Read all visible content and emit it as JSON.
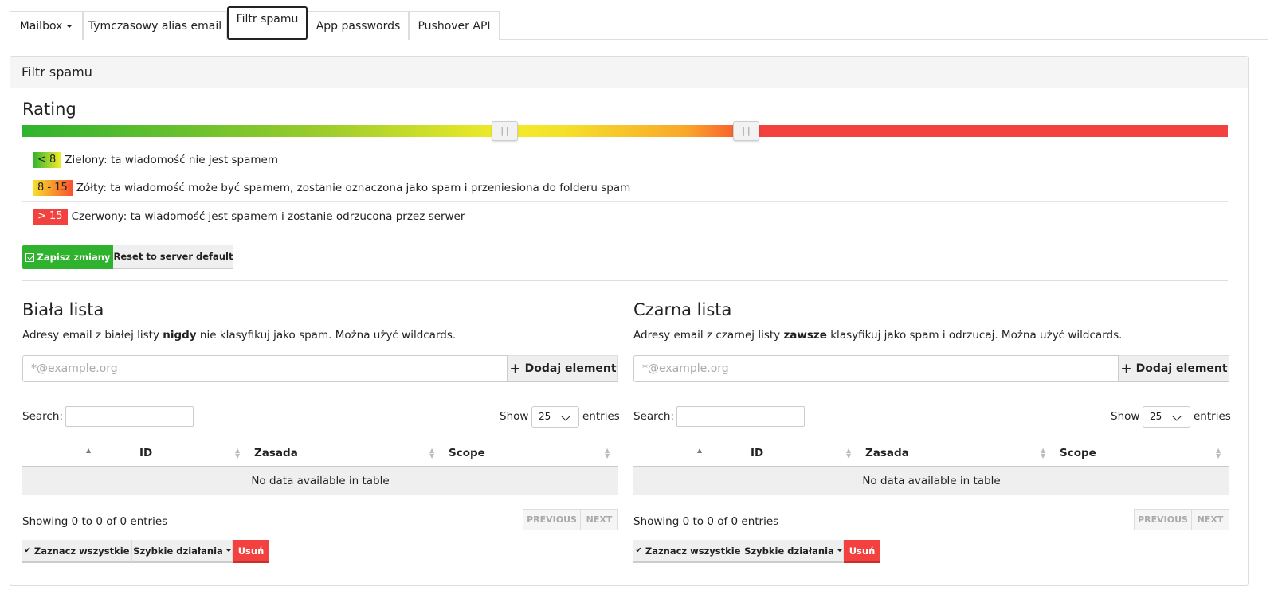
{
  "tabs": [
    {
      "label": "Mailbox",
      "dropdown": true
    },
    {
      "label": "Tymczasowy alias email"
    },
    {
      "label": "Filtr spamu",
      "active": true
    },
    {
      "label": "App passwords"
    },
    {
      "label": "Pushover API"
    }
  ],
  "panel": {
    "title": "Filtr spamu",
    "rating_title": "Rating",
    "slider": {
      "low": 8,
      "high": 15
    },
    "rating_rows": [
      {
        "badge": "< 8",
        "text": "Zielony: ta wiadomość nie jest spamem",
        "color": "green"
      },
      {
        "badge": "8 - 15",
        "text": "Żółty: ta wiadomość może być spamem, zostanie oznaczona jako spam i przeniesiona do folderu spam",
        "color": "yellow"
      },
      {
        "badge": "> 15",
        "text": "Czerwony: ta wiadomość jest spamem i zostanie odrzucona przez serwer",
        "color": "red"
      }
    ],
    "save_label": "Zapisz zmiany",
    "reset_label": "Reset to server default"
  },
  "whitelist": {
    "title": "Biała lista",
    "desc_pre": "Adresy email z białej listy ",
    "desc_bold": "nigdy",
    "desc_post": " nie klasyfikuj jako spam. Można użyć wildcards.",
    "placeholder": "*@example.org",
    "add_label": "Dodaj element",
    "search_label": "Search:",
    "show_label": "Show",
    "show_value": "25",
    "entries_label": "entries",
    "columns": [
      "ID",
      "Zasada",
      "Scope"
    ],
    "empty": "No data available in table",
    "showing": "Showing 0 to 0 of 0 entries",
    "prev": "PREVIOUS",
    "next": "NEXT",
    "select_all": "Zaznacz wszystkie",
    "quick_actions": "Szybkie działania",
    "delete": "Usuń"
  },
  "blacklist": {
    "title": "Czarna lista",
    "desc_pre": "Adresy email z czarnej listy ",
    "desc_bold": "zawsze",
    "desc_post": " klasyfikuj jako spam i odrzucaj. Można użyć wildcards.",
    "placeholder": "*@example.org",
    "add_label": "Dodaj element",
    "search_label": "Search:",
    "show_label": "Show",
    "show_value": "25",
    "entries_label": "entries",
    "columns": [
      "ID",
      "Zasada",
      "Scope"
    ],
    "empty": "No data available in table",
    "showing": "Showing 0 to 0 of 0 entries",
    "prev": "PREVIOUS",
    "next": "NEXT",
    "select_all": "Zaznacz wszystkie",
    "quick_actions": "Szybkie działania",
    "delete": "Usuń"
  },
  "colors": {
    "green": "#2fb32f",
    "red": "#f2413f",
    "yellow": "#f2ec2a"
  }
}
